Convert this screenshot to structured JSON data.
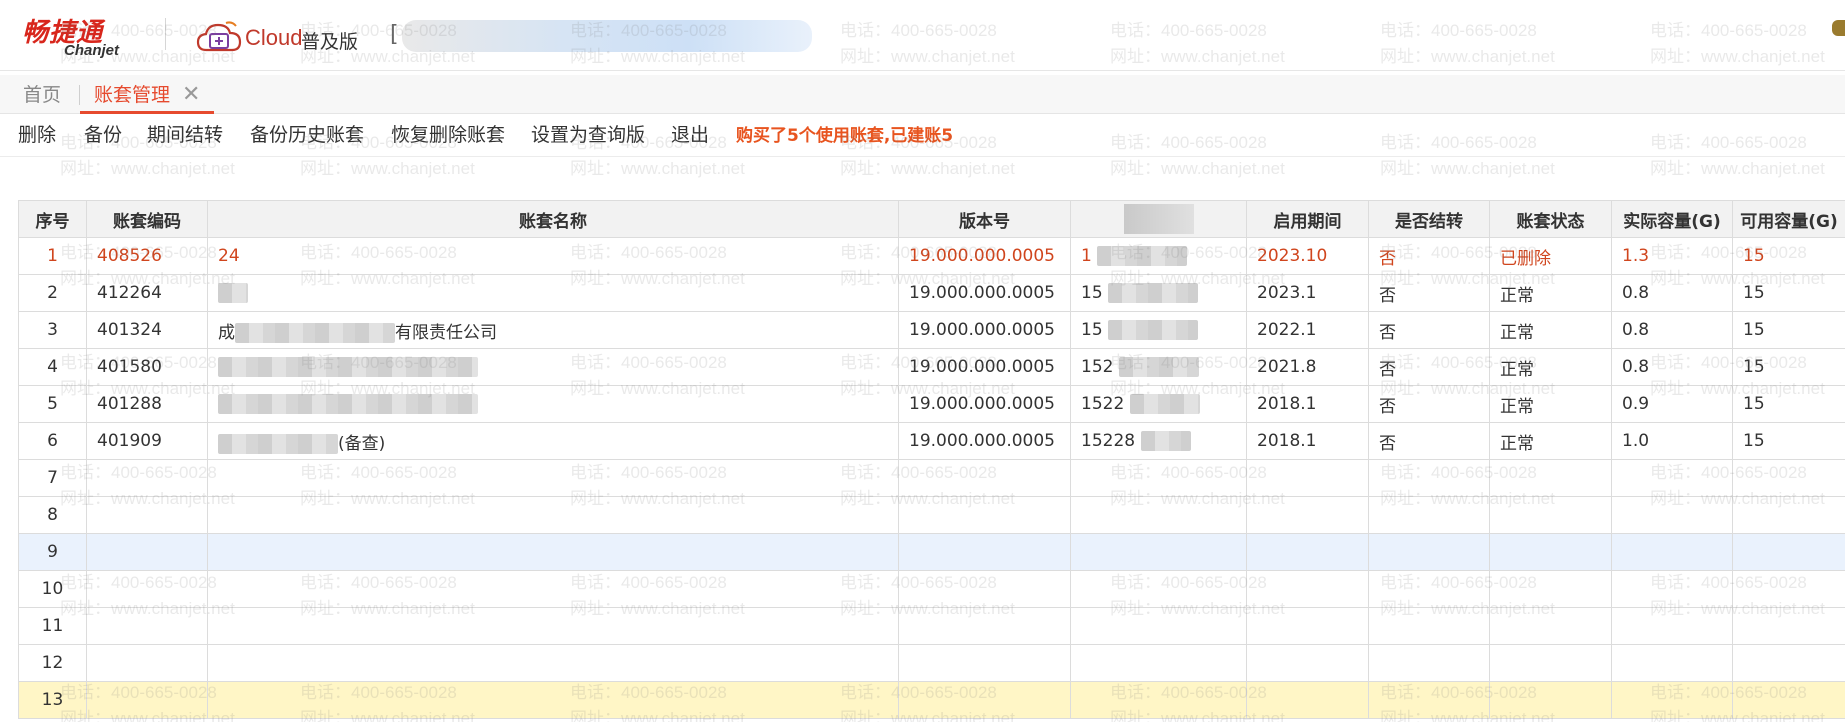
{
  "header": {
    "brand_cn": "畅捷通",
    "brand_en": "Chanjet",
    "cloud_label": "Cloud",
    "edition": "普及版",
    "company_bracket": "["
  },
  "tabs": [
    {
      "label": "首页"
    },
    {
      "label": "账套管理",
      "active": true
    }
  ],
  "tab_close_glyph": "✕",
  "toolbar": {
    "buttons": [
      "删除",
      "备份",
      "期间结转",
      "备份历史账套",
      "恢复删除账套",
      "设置为查询版",
      "退出"
    ],
    "notice": "购买了5个使用账套,已建账5"
  },
  "table": {
    "columns": [
      "序号",
      "账套编码",
      "账套名称",
      "版本号",
      "",
      "启用期间",
      "是否结转",
      "账套状态",
      "实际容量(G)",
      "可用容量(G)"
    ],
    "rows": [
      {
        "idx": "1",
        "code": "408526",
        "name": "24",
        "version": "19.000.000.0005",
        "extra": "1",
        "period": "2023.10",
        "closed": "否",
        "status": "已删除",
        "used": "1.3",
        "avail": "15"
      },
      {
        "idx": "2",
        "code": "412264",
        "name": "",
        "version": "19.000.000.0005",
        "extra": "15",
        "period": "2023.1",
        "closed": "否",
        "status": "正常",
        "used": "0.8",
        "avail": "15"
      },
      {
        "idx": "3",
        "code": "401324",
        "name": "成",
        "name_tail": "有限责任公司",
        "version": "19.000.000.0005",
        "extra": "15",
        "period": "2022.1",
        "closed": "否",
        "status": "正常",
        "used": "0.8",
        "avail": "15"
      },
      {
        "idx": "4",
        "code": "401580",
        "name": "",
        "version": "19.000.000.0005",
        "extra": "152",
        "period": "2021.8",
        "closed": "否",
        "status": "正常",
        "used": "0.8",
        "avail": "15"
      },
      {
        "idx": "5",
        "code": "401288",
        "name": "",
        "version": "19.000.000.0005",
        "extra": "1522",
        "period": "2018.1",
        "closed": "否",
        "status": "正常",
        "used": "0.9",
        "avail": "15"
      },
      {
        "idx": "6",
        "code": "401909",
        "name": "",
        "name_tail": "(备查)",
        "version": "19.000.000.0005",
        "extra": "15228",
        "period": "2018.1",
        "closed": "否",
        "status": "正常",
        "used": "1.0",
        "avail": "15"
      },
      {
        "idx": "7"
      },
      {
        "idx": "8"
      },
      {
        "idx": "9"
      },
      {
        "idx": "10"
      },
      {
        "idx": "11"
      },
      {
        "idx": "12"
      },
      {
        "idx": "13"
      }
    ]
  },
  "watermark": {
    "phone": "电话：400-665-0028",
    "site": "网址：www.chanjet.net"
  },
  "colors": {
    "brand_red": "#d8261c",
    "accent_orange": "#e64a2e",
    "deleted_row": "#d0451d",
    "selected_row": "#eaf2fd",
    "highlight_row": "#fff6c6"
  }
}
